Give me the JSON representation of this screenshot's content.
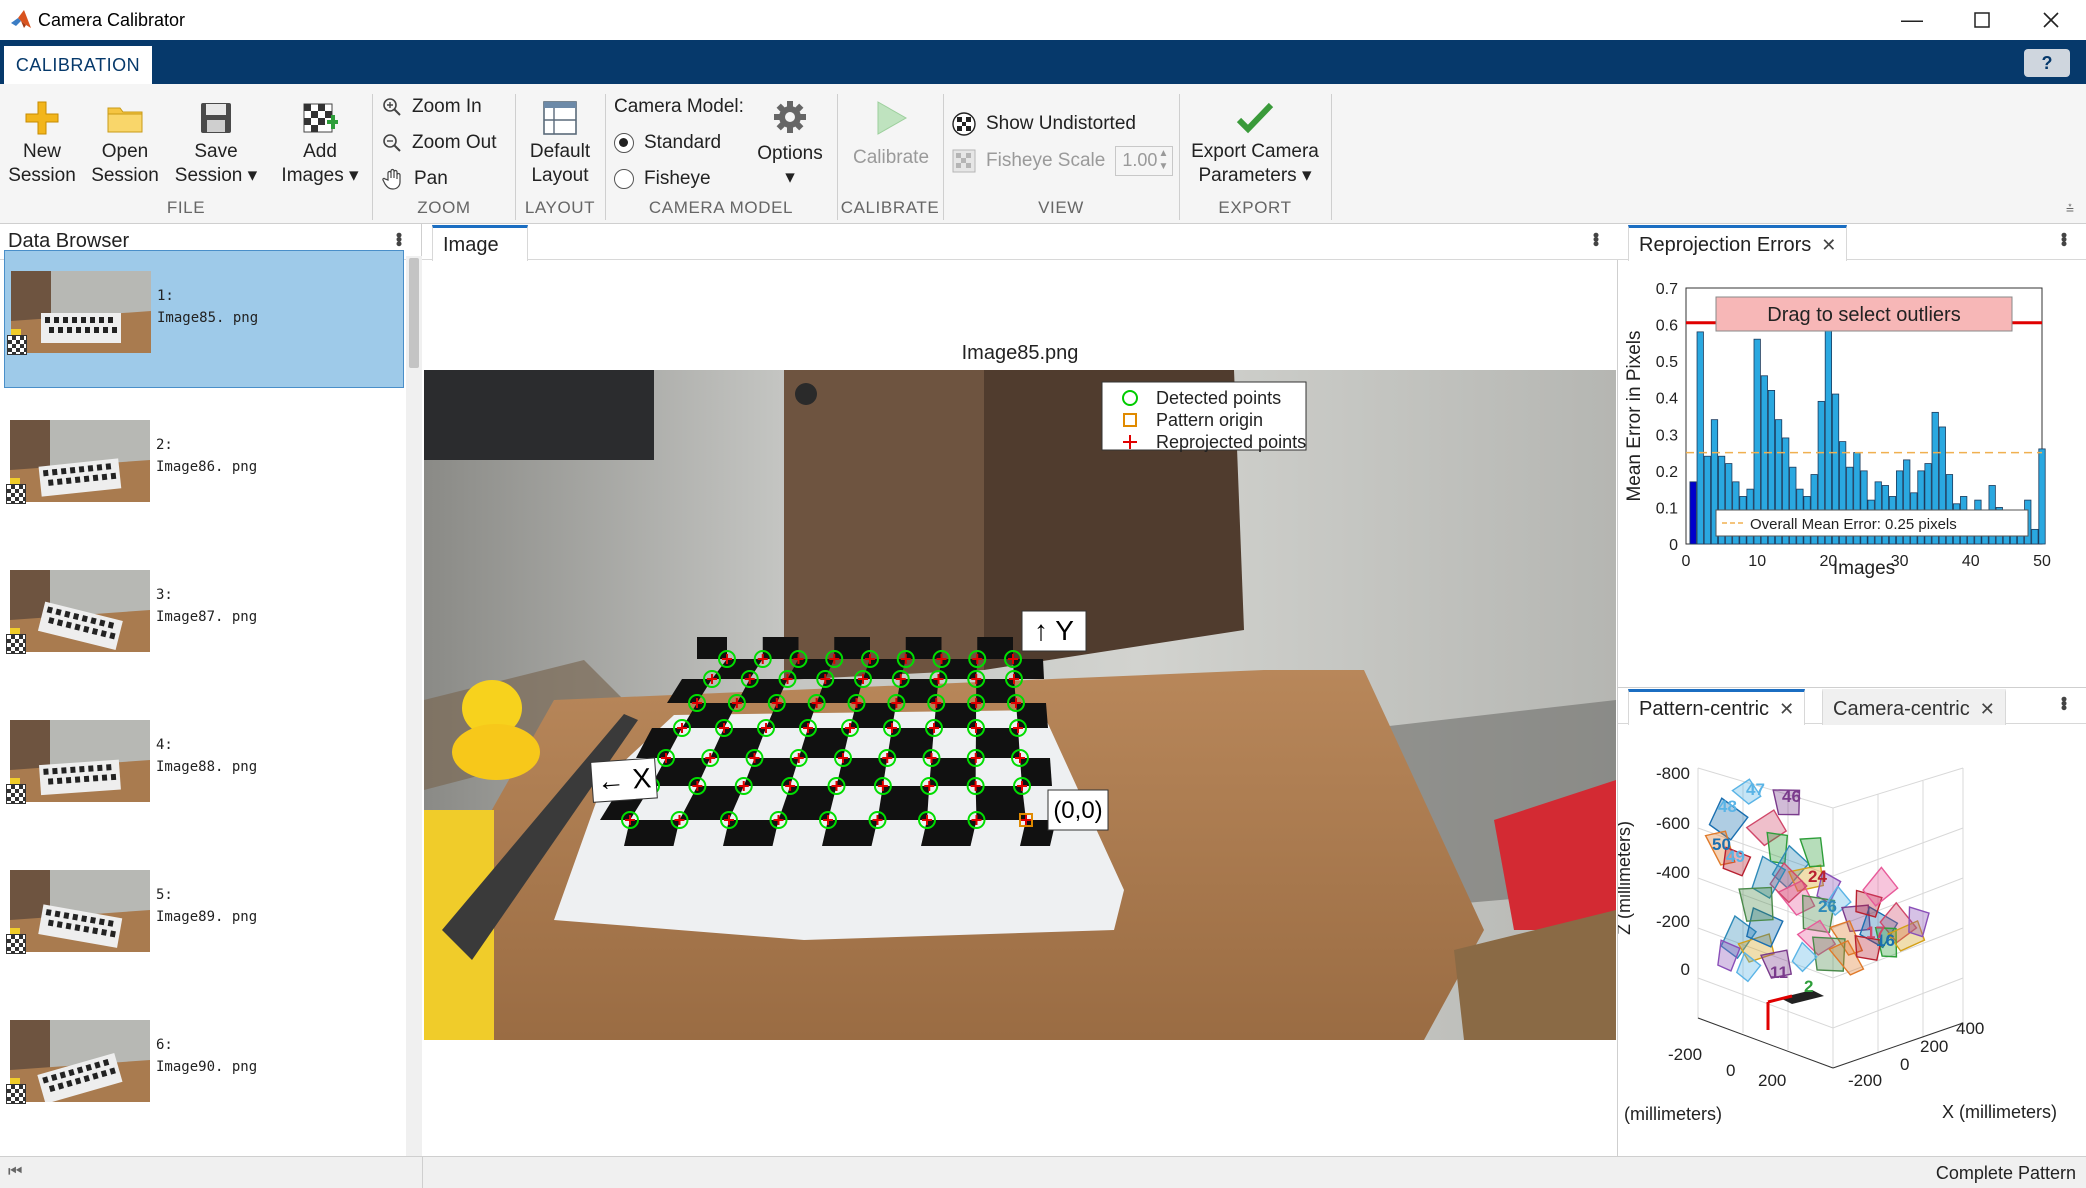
{
  "window": {
    "title": "Camera Calibrator",
    "minimize_icon": "minimize-icon",
    "maximize_icon": "maximize-icon",
    "close_icon": "close-icon"
  },
  "tabs": {
    "active": "CALIBRATION",
    "help": "?"
  },
  "ribbon": {
    "file": {
      "new": [
        "New",
        "Session"
      ],
      "open": [
        "Open",
        "Session"
      ],
      "save": [
        "Save",
        "Session"
      ],
      "add": [
        "Add",
        "Images"
      ],
      "label": "FILE"
    },
    "zoom": {
      "zoom_in": "Zoom In",
      "zoom_out": "Zoom Out",
      "pan": "Pan",
      "label": "ZOOM"
    },
    "layout": {
      "default": [
        "Default",
        "Layout"
      ],
      "label": "LAYOUT"
    },
    "camera_model": {
      "heading": "Camera Model:",
      "standard": "Standard",
      "fisheye": "Fisheye",
      "selected": "Standard",
      "options": "Options",
      "label": "CAMERA MODEL"
    },
    "calibrate": {
      "button": "Calibrate",
      "label": "CALIBRATE"
    },
    "view": {
      "show_undistorted": "Show Undistorted",
      "fisheye_scale": "Fisheye Scale",
      "fisheye_scale_value": "1.00",
      "label": "VIEW"
    },
    "export": {
      "button": [
        "Export Camera",
        "Parameters"
      ],
      "label": "EXPORT"
    }
  },
  "data_browser": {
    "title": "Data Browser",
    "items": [
      {
        "index": "1:",
        "file": "Image85. png",
        "selected": true
      },
      {
        "index": "2:",
        "file": "Image86. png",
        "selected": false
      },
      {
        "index": "3:",
        "file": "Image87. png",
        "selected": false
      },
      {
        "index": "4:",
        "file": "Image88. png",
        "selected": false
      },
      {
        "index": "5:",
        "file": "Image89. png",
        "selected": false
      },
      {
        "index": "6:",
        "file": "Image90. png",
        "selected": false
      }
    ]
  },
  "image_panel": {
    "tab": "Image",
    "image_title": "Image85.png",
    "legend": {
      "detected": "Detected points",
      "origin": "Pattern origin",
      "reprojected": "Reprojected points"
    },
    "annotations": {
      "y_axis": "↑ Y",
      "x_axis": "← X",
      "origin": "(0,0)"
    }
  },
  "reprojection": {
    "tab": "Reprojection Errors",
    "drag_hint": "Drag to select outliers",
    "overall_mean": "Overall Mean Error: 0.25 pixels",
    "colors": {
      "bar": "#2aa8e0",
      "selected_bar": "#0000cc",
      "threshold": "#e00000",
      "mean_line": "#f0b050"
    }
  },
  "extrinsics": {
    "tab_pattern": "Pattern-centric",
    "tab_camera": "Camera-centric",
    "z_label": "Z (millimeters)",
    "y_label": "(millimeters)",
    "x_label": "X (millimeters)",
    "z_ticks": [
      "-800",
      "-600",
      "-400",
      "-200",
      "0"
    ],
    "y_ticks": [
      "-200",
      "0",
      "200"
    ],
    "x_ticks": [
      "-200",
      "0",
      "200",
      "400"
    ],
    "camera_labels": [
      "47",
      "46",
      "48",
      "50",
      "49",
      "24",
      "11",
      "16",
      "17",
      "2",
      "26"
    ]
  },
  "status": {
    "text": "Complete Pattern"
  },
  "chart_data": {
    "type": "bar",
    "title": "",
    "xlabel": "Images",
    "ylabel": "Mean Error in Pixels",
    "ylim": [
      0,
      0.7
    ],
    "xlim": [
      0,
      50
    ],
    "yticks": [
      "0",
      "0.1",
      "0.2",
      "0.3",
      "0.4",
      "0.5",
      "0.6",
      "0.7"
    ],
    "xticks": [
      "0",
      "10",
      "20",
      "30",
      "40",
      "50"
    ],
    "threshold": 0.605,
    "overall_mean": 0.25,
    "selected_image": 1,
    "categories": [
      1,
      2,
      3,
      4,
      5,
      6,
      7,
      8,
      9,
      10,
      11,
      12,
      13,
      14,
      15,
      16,
      17,
      18,
      19,
      20,
      21,
      22,
      23,
      24,
      25,
      26,
      27,
      28,
      29,
      30,
      31,
      32,
      33,
      34,
      35,
      36,
      37,
      38,
      39,
      40,
      41,
      42,
      43,
      44,
      45,
      46,
      47,
      48,
      49,
      50
    ],
    "values": [
      0.17,
      0.58,
      0.24,
      0.34,
      0.24,
      0.22,
      0.17,
      0.13,
      0.15,
      0.56,
      0.46,
      0.42,
      0.34,
      0.29,
      0.21,
      0.15,
      0.13,
      0.19,
      0.39,
      0.62,
      0.41,
      0.28,
      0.21,
      0.25,
      0.2,
      0.12,
      0.17,
      0.16,
      0.13,
      0.2,
      0.23,
      0.14,
      0.2,
      0.22,
      0.36,
      0.32,
      0.19,
      0.11,
      0.13,
      0.09,
      0.12,
      0.08,
      0.16,
      0.1,
      0.06,
      0.04,
      0.08,
      0.12,
      0.04,
      0.26
    ]
  }
}
